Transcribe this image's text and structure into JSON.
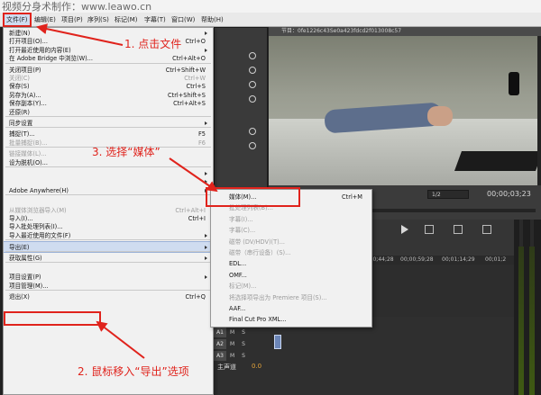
{
  "watermark": "视频分身术制作：www.leawo.cn",
  "menubar": {
    "items": [
      "文件(F)",
      "编辑(E)",
      "项目(P)",
      "序列(S)",
      "标记(M)",
      "字幕(T)",
      "窗口(W)",
      "帮助(H)"
    ]
  },
  "program_monitor": {
    "title": "节目：0fe1226c43Se0a423fdcd2f013008c57",
    "zoom_value": "1/2",
    "timecode": "00;00;03;23"
  },
  "timeline": {
    "ruler": [
      "00;00;44;28",
      "00;00;59;28",
      "00;01;14;29",
      "00;01;2"
    ],
    "tracks": [
      {
        "label": "A1",
        "toggles": "M S"
      },
      {
        "label": "A2",
        "toggles": "M S"
      },
      {
        "label": "A3",
        "toggles": "M S"
      }
    ],
    "master_label": "主声道",
    "master_value": "0.0"
  },
  "file_menu": {
    "items": [
      {
        "label": "新建(N)",
        "shortcut": "",
        "submenu": true,
        "disabled": false
      },
      {
        "label": "打开项目(O)...",
        "shortcut": "Ctrl+O",
        "submenu": false,
        "disabled": false
      },
      {
        "label": "打开最近使用的内容(E)",
        "shortcut": "",
        "submenu": true,
        "disabled": false
      },
      {
        "label": "在 Adobe Bridge 中浏览(W)...",
        "shortcut": "Ctrl+Alt+O",
        "submenu": false,
        "disabled": false
      },
      {
        "sep": true
      },
      {
        "label": "关闭项目(P)",
        "shortcut": "Ctrl+Shift+W",
        "submenu": false,
        "disabled": false
      },
      {
        "label": "关闭(C)",
        "shortcut": "Ctrl+W",
        "submenu": false,
        "disabled": true
      },
      {
        "label": "保存(S)",
        "shortcut": "Ctrl+S",
        "submenu": false,
        "disabled": false
      },
      {
        "label": "另存为(A)...",
        "shortcut": "Ctrl+Shift+S",
        "submenu": false,
        "disabled": false
      },
      {
        "label": "保存副本(Y)...",
        "shortcut": "Ctrl+Alt+S",
        "submenu": false,
        "disabled": false
      },
      {
        "label": "还原(R)",
        "shortcut": "",
        "submenu": false,
        "disabled": false
      },
      {
        "sep": true
      },
      {
        "label": "同步设置",
        "shortcut": "",
        "submenu": true,
        "disabled": false
      },
      {
        "sep": true
      },
      {
        "label": "捕捉(T)...",
        "shortcut": "F5",
        "submenu": false,
        "disabled": false
      },
      {
        "label": "批量捕捉(B)...",
        "shortcut": "F6",
        "submenu": false,
        "disabled": true
      },
      {
        "sep": true
      },
      {
        "label": "链接媒体(L)...",
        "shortcut": "",
        "submenu": false,
        "disabled": true
      },
      {
        "label": "设为脱机(O)...",
        "shortcut": "",
        "submenu": false,
        "disabled": false
      },
      {
        "sep": true
      },
      {
        "label": "",
        "shortcut": "",
        "submenu": true,
        "disabled": false
      },
      {
        "label": "",
        "shortcut": "",
        "submenu": true,
        "disabled": false
      },
      {
        "label": "Adobe Anywhere(H)",
        "shortcut": "",
        "submenu": true,
        "disabled": false
      },
      {
        "sep": true
      },
      {
        "label": "",
        "shortcut": "",
        "submenu": false,
        "disabled": false
      },
      {
        "label": "从媒体浏览器导入(M)",
        "shortcut": "Ctrl+Alt+I",
        "submenu": false,
        "disabled": true
      },
      {
        "label": "导入(I)...",
        "shortcut": "Ctrl+I",
        "submenu": false,
        "disabled": false
      },
      {
        "label": "导入批处理列表(I)...",
        "shortcut": "",
        "submenu": false,
        "disabled": false
      },
      {
        "label": "导入最近使用的文件(F)",
        "shortcut": "",
        "submenu": true,
        "disabled": false
      },
      {
        "sep": true
      },
      {
        "label": "导出(E)",
        "shortcut": "",
        "submenu": true,
        "disabled": false,
        "highlight": true
      },
      {
        "sep": true
      },
      {
        "label": "获取属性(G)",
        "shortcut": "",
        "submenu": true,
        "disabled": false
      },
      {
        "sep": true
      },
      {
        "label": "",
        "shortcut": "",
        "submenu": false,
        "disabled": false
      },
      {
        "label": "项目设置(P)",
        "shortcut": "",
        "submenu": true,
        "disabled": false
      },
      {
        "label": "项目管理(M)...",
        "shortcut": "",
        "submenu": false,
        "disabled": false
      },
      {
        "sep": true
      },
      {
        "label": "退出(X)",
        "shortcut": "Ctrl+Q",
        "submenu": false,
        "disabled": false
      }
    ]
  },
  "export_submenu": {
    "items": [
      {
        "label": "媒体(M)...",
        "shortcut": "Ctrl+M",
        "disabled": false
      },
      {
        "label": "批处理列表(B)...",
        "shortcut": "",
        "disabled": true
      },
      {
        "label": "字幕(I)...",
        "shortcut": "",
        "disabled": true
      },
      {
        "label": "字幕(C)...",
        "shortcut": "",
        "disabled": true
      },
      {
        "label": "磁带 (DV/HDV)(T)...",
        "shortcut": "",
        "disabled": true
      },
      {
        "label": "磁带（串行设备）(S)...",
        "shortcut": "",
        "disabled": true
      },
      {
        "label": "EDL...",
        "shortcut": "",
        "disabled": false
      },
      {
        "label": "OMF...",
        "shortcut": "",
        "disabled": false
      },
      {
        "label": "标记(M)...",
        "shortcut": "",
        "disabled": true
      },
      {
        "label": "将选择项导出为 Premiere 项目(S)...",
        "shortcut": "",
        "disabled": true
      },
      {
        "label": "AAF...",
        "shortcut": "",
        "disabled": false
      },
      {
        "label": "Final Cut Pro XML...",
        "shortcut": "",
        "disabled": false
      }
    ]
  },
  "annotations": {
    "step1": "1. 点击文件",
    "step2": "2. 鼠标移入“导出”选项",
    "step3": "3. 选择“媒体”"
  },
  "colors": {
    "annotation_red": "#e0231c",
    "menu_bg": "#f1f1f1",
    "highlight": "#cfdcf0"
  }
}
